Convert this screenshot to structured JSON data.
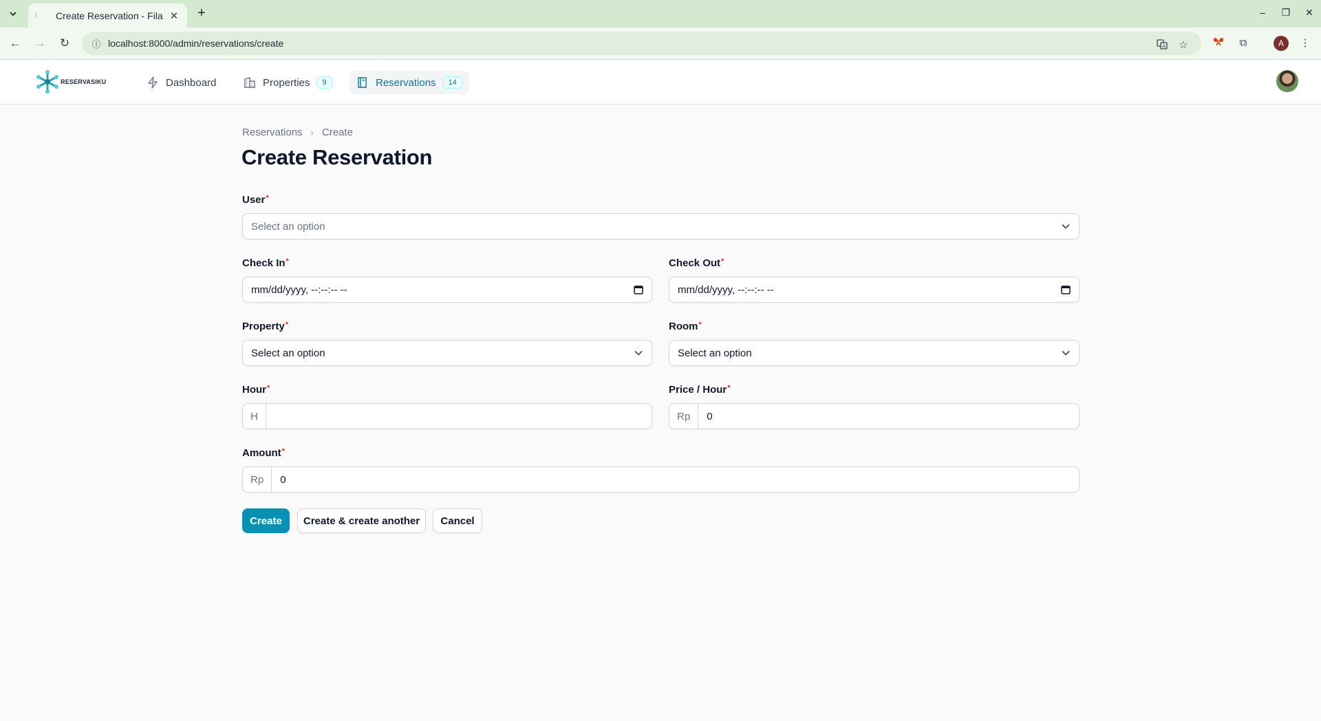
{
  "browser": {
    "tab_title": "Create Reservation - Fila",
    "url": "localhost:8000/admin/reservations/create",
    "profile_initial": "A"
  },
  "app": {
    "logo_text": "RESERVASIKU",
    "nav": [
      {
        "label": "Dashboard",
        "icon": "bolt-icon"
      },
      {
        "label": "Properties",
        "icon": "building-icon",
        "badge": "9"
      },
      {
        "label": "Reservations",
        "icon": "book-icon",
        "badge": "14",
        "active": true
      }
    ]
  },
  "breadcrumb": [
    "Reservations",
    "Create"
  ],
  "page_title": "Create Reservation",
  "form": {
    "user": {
      "label": "User",
      "required_mark": "*",
      "placeholder": "Select an option"
    },
    "check_in": {
      "label": "Check In",
      "required_mark": "*",
      "value": "mm/dd/yyyy, --:--:-- --"
    },
    "check_out": {
      "label": "Check Out",
      "required_mark": "*",
      "value": "mm/dd/yyyy, --:--:-- --"
    },
    "property": {
      "label": "Property",
      "required_mark": "*",
      "value": "Select an option"
    },
    "room": {
      "label": "Room",
      "required_mark": "*",
      "value": "Select an option"
    },
    "hour": {
      "label": "Hour",
      "required_mark": "*",
      "prefix": "H",
      "value": ""
    },
    "price_hour": {
      "label": "Price / Hour",
      "required_mark": "*",
      "prefix": "Rp",
      "value": "0"
    },
    "amount": {
      "label": "Amount",
      "required_mark": "*",
      "prefix": "Rp",
      "value": "0"
    }
  },
  "actions": {
    "create": "Create",
    "create_another": "Create & create another",
    "cancel": "Cancel"
  },
  "colors": {
    "primary": "#0891b2",
    "required": "#dc2626",
    "chrome": "#d3e9d0"
  }
}
